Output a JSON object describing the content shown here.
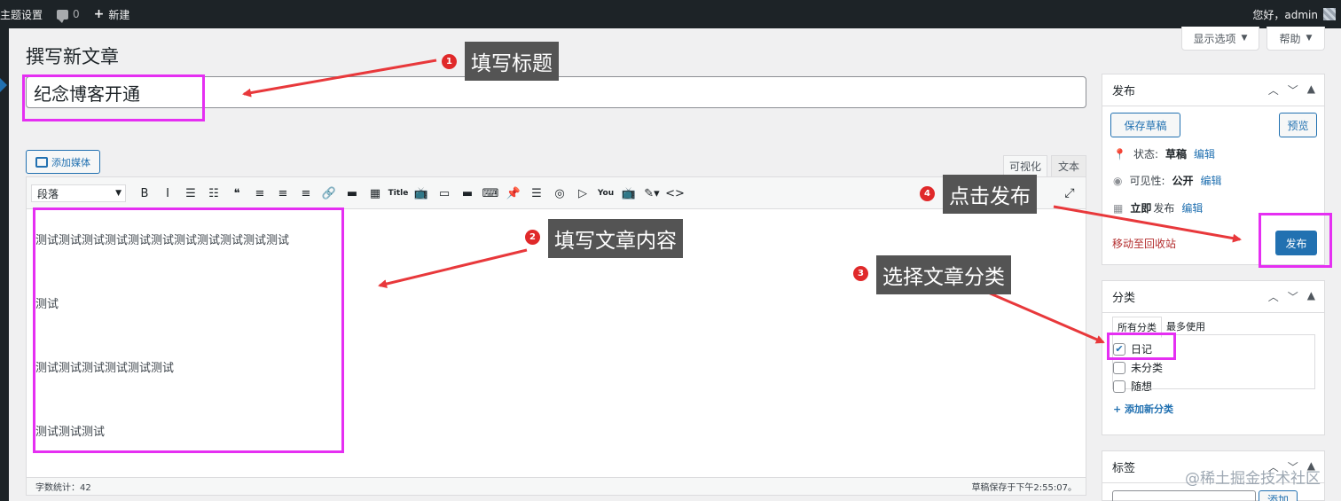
{
  "adminbar": {
    "theme_settings": "主题设置",
    "comments_count": "0",
    "new_label": "新建",
    "greeting": "您好，admin"
  },
  "screen_options": {
    "options_label": "显示选项",
    "help_label": "帮助"
  },
  "page": {
    "title": "撰写新文章"
  },
  "post": {
    "title_value": "纪念博客开通"
  },
  "editor": {
    "add_media": "添加媒体",
    "tab_visual": "可视化",
    "tab_text": "文本",
    "format_select": "段落",
    "toolbar_icons": [
      {
        "name": "bold-icon",
        "glyph": "B"
      },
      {
        "name": "italic-icon",
        "glyph": "I"
      },
      {
        "name": "bullet-list-icon",
        "glyph": "☰"
      },
      {
        "name": "numbered-list-icon",
        "glyph": "☷"
      },
      {
        "name": "blockquote-icon",
        "glyph": "❝"
      },
      {
        "name": "align-left-icon",
        "glyph": "≡"
      },
      {
        "name": "align-center-icon",
        "glyph": "≡"
      },
      {
        "name": "align-right-icon",
        "glyph": "≡"
      },
      {
        "name": "link-icon",
        "glyph": "🔗"
      },
      {
        "name": "read-more-icon",
        "glyph": "▬"
      },
      {
        "name": "toolbar-toggle-icon",
        "glyph": "▦"
      },
      {
        "name": "title-icon",
        "glyph": "Title"
      },
      {
        "name": "tv-icon",
        "glyph": "📺"
      },
      {
        "name": "window-icon",
        "glyph": "▭"
      },
      {
        "name": "hd-icon",
        "glyph": "▬"
      },
      {
        "name": "keyboard-icon",
        "glyph": "⌨"
      },
      {
        "name": "pin-icon",
        "glyph": "📌"
      },
      {
        "name": "layers-icon",
        "glyph": "☰"
      },
      {
        "name": "music-icon",
        "glyph": "◎"
      },
      {
        "name": "play-icon",
        "glyph": "▷"
      },
      {
        "name": "youtube-icon",
        "glyph": "You"
      },
      {
        "name": "video-icon",
        "glyph": "📺"
      },
      {
        "name": "edit-icon",
        "glyph": "✎▾"
      },
      {
        "name": "code-icon",
        "glyph": "<>"
      }
    ],
    "paragraphs": [
      "测试测试测试测试测试测试测试测试测试测试测试",
      "测试",
      "测试测试测试测试测试测试",
      "测试测试测试"
    ],
    "word_count": "字数统计：42",
    "autosave": "草稿保存于下午2:55:07。"
  },
  "publish_box": {
    "title": "发布",
    "save_draft": "保存草稿",
    "preview": "预览",
    "status_label": "状态:",
    "status_value": "草稿",
    "visibility_label": "可见性:",
    "visibility_value": "公开",
    "schedule_value": "立即",
    "schedule_label": "发布",
    "edit_label": "编辑",
    "trash": "移动至回收站",
    "publish": "发布"
  },
  "category_box": {
    "title": "分类",
    "tab_all": "所有分类",
    "tab_popular": "最多使用",
    "items": [
      {
        "label": "日记",
        "checked": true
      },
      {
        "label": "未分类",
        "checked": false
      },
      {
        "label": "随想",
        "checked": false
      }
    ],
    "add_new": "+ 添加新分类"
  },
  "tag_box": {
    "title": "标签",
    "add_button": "添加"
  },
  "annotations": {
    "step1": {
      "num": "1",
      "text": "填写标题"
    },
    "step2": {
      "num": "2",
      "text": "填写文章内容"
    },
    "step3": {
      "num": "3",
      "text": "选择文章分类"
    },
    "step4": {
      "num": "4",
      "text": "点击发布"
    }
  },
  "watermark": "@稀土掘金技术社区",
  "colors": {
    "accent": "#2271b1",
    "highlight": "#e52ff2",
    "arrow": "#e8383b",
    "callout": "#545454"
  }
}
